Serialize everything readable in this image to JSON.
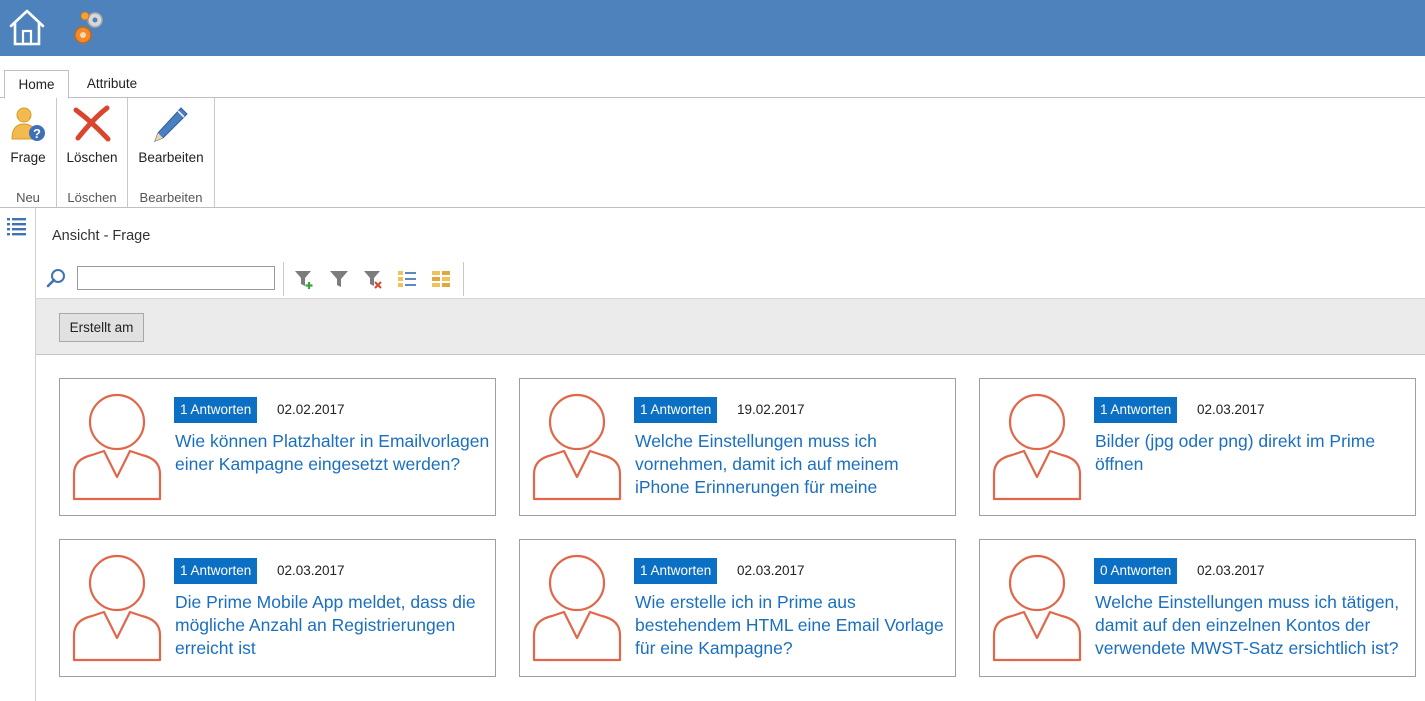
{
  "topbar": {
    "icons": [
      "home-icon",
      "gears-icon"
    ]
  },
  "tabs": [
    {
      "label": "Home",
      "active": true
    },
    {
      "label": "Attribute",
      "active": false
    }
  ],
  "ribbon": {
    "groups": [
      {
        "button_label": "Frage",
        "icon": "user-question-icon",
        "group_label": "Neu"
      },
      {
        "button_label": "Löschen",
        "icon": "delete-x-icon",
        "group_label": "Löschen"
      },
      {
        "button_label": "Bearbeiten",
        "icon": "pencil-icon",
        "group_label": "Bearbeiten"
      }
    ]
  },
  "sidebar": {
    "icon": "list-icon"
  },
  "view": {
    "title": "Ansicht - Frage"
  },
  "search": {
    "value": "",
    "placeholder": ""
  },
  "toolbar": {
    "icons": [
      "filter-add-icon",
      "filter-icon",
      "filter-remove-icon",
      "list-view-icon",
      "grid-view-icon"
    ]
  },
  "grouping": {
    "button_label": "Erstellt am"
  },
  "colors": {
    "topbar": "#4d82bc",
    "badge": "#0b6fc4",
    "link": "#1a6fbf",
    "avatar": "#e0674a"
  },
  "cards": [
    {
      "answers": "1 Antworten",
      "date": "02.02.2017",
      "question": "Wie können Platzhalter in Emailvorlagen einer Kampagne eingesetzt werden?"
    },
    {
      "answers": "1 Antworten",
      "date": "19.02.2017",
      "question": "Welche Einstellungen muss ich vornehmen, damit ich auf meinem iPhone Erinnerungen für meine"
    },
    {
      "answers": "1 Antworten",
      "date": "02.03.2017",
      "question": "Bilder (jpg oder png) direkt im Prime öffnen"
    },
    {
      "answers": "1 Antworten",
      "date": "02.03.2017",
      "question": "Die Prime Mobile App meldet, dass die mögliche Anzahl an Registrierungen erreicht ist"
    },
    {
      "answers": "1 Antworten",
      "date": "02.03.2017",
      "question": "Wie erstelle ich in Prime aus bestehendem HTML eine Email Vorlage für eine Kampagne?"
    },
    {
      "answers": "0 Antworten",
      "date": "02.03.2017",
      "question": "Welche Einstellungen muss ich tätigen, damit auf den einzelnen Kontos der verwendete MWST-Satz ersichtlich ist?"
    }
  ]
}
